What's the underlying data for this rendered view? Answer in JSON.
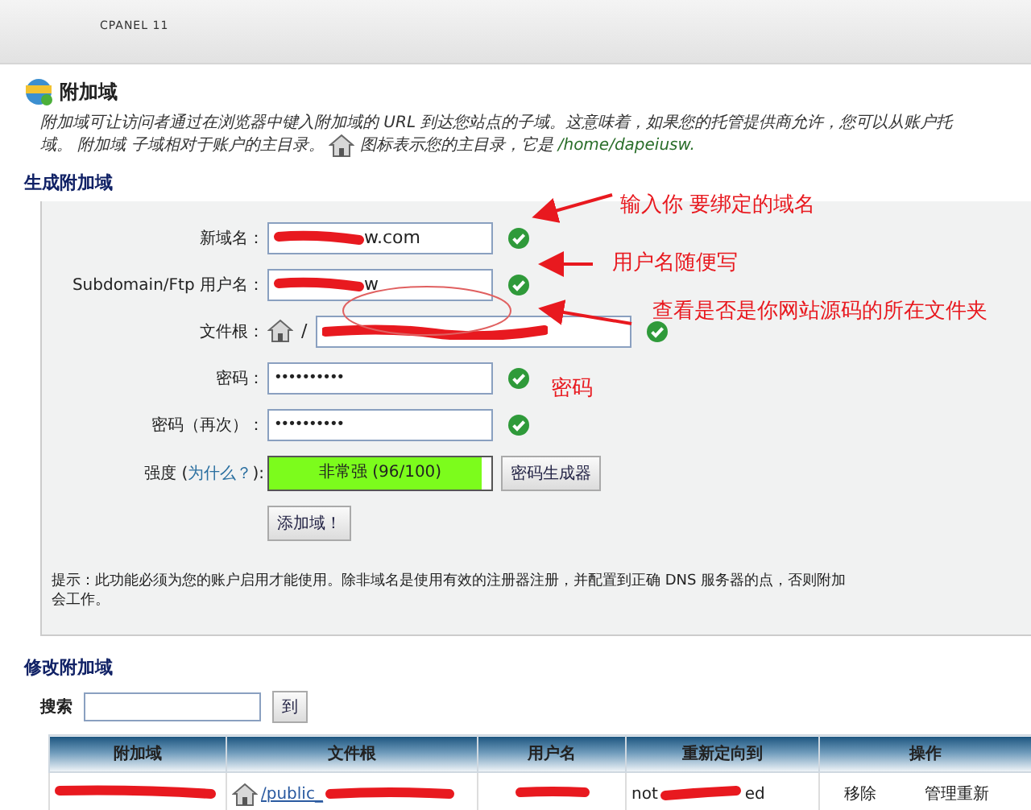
{
  "header": {
    "brand": "CPANEL 11"
  },
  "page": {
    "title": "附加域",
    "description": {
      "line1": "附加域可让访问者通过在浏览器中键入附加域的 URL 到达您站点的子域。这意味着，如果您的托管提供商允许，您可以从账户托",
      "line2_before": "域。 附加域 子域相对于账户的主目录。",
      "line2_after": "图标表示您的主目录，它是",
      "home_path": "/home/dapeiusw."
    }
  },
  "create": {
    "heading": "生成附加域",
    "fields": [
      {
        "label": "新域名：",
        "kind": "text",
        "value": "w.com",
        "redacted": true,
        "valid": true
      },
      {
        "label": "Subdomain/Ftp 用户名：",
        "kind": "text",
        "value": "w",
        "redacted": true,
        "valid": true
      },
      {
        "label": "文件根：",
        "kind": "docroot",
        "prefix": "/",
        "redacted": true,
        "valid": true
      },
      {
        "label": "密码：",
        "kind": "password",
        "value": "••••••••••",
        "valid": true
      },
      {
        "label": "密码（再次）：",
        "kind": "password",
        "value": "••••••••••",
        "valid": true
      }
    ],
    "strength": {
      "label_before": "强度 (",
      "link": "为什么？",
      "label_after": "):",
      "reading": "非常强 (96/100)",
      "level": 0.96
    },
    "generator_button": "密码生成器",
    "submit_button": "添加域！",
    "hint_lines": [
      "提示：此功能必须为您的账户启用才能使用。除非域名是使用有效的注册器注册，并配置到正确 DNS 服务器的点，否则附加",
      "会工作。"
    ]
  },
  "manage": {
    "heading": "修改附加域",
    "search": {
      "label": "搜索",
      "button": "到"
    },
    "table": {
      "columns": [
        "附加域",
        "文件根",
        "用户名",
        "重新定向到",
        "操作"
      ],
      "rows": [
        {
          "domain_redacted": true,
          "docroot": "/public_",
          "docroot_redacted": true,
          "user_redacted": true,
          "redirect_before": "not",
          "redirect_after": "ed",
          "actions": [
            "移除",
            "管理重新"
          ]
        }
      ]
    }
  },
  "annotations": [
    {
      "text": "输入你 要绑定的域名"
    },
    {
      "text": "用户名随便写"
    },
    {
      "text": "查看是否是你网站源码的所在文件夹"
    },
    {
      "text": "密码"
    }
  ]
}
